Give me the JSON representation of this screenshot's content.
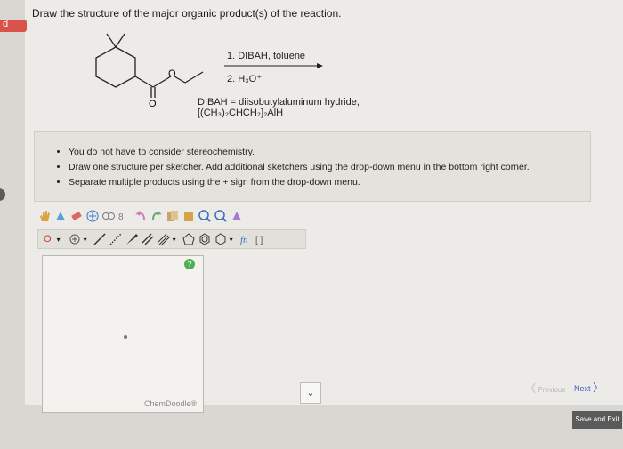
{
  "question": "Draw the structure of the major organic product(s) of the reaction.",
  "reaction": {
    "step1": "1. DIBAH, toluene",
    "step2": "2. H₃O⁺",
    "dibah_line1": "DIBAH = diisobutylaluminum hydride,",
    "dibah_line2": "[(CH₃)₂CHCH₂]₂AlH",
    "atom_o1": "O",
    "atom_o2": "O"
  },
  "instructions": [
    "You do not have to consider stereochemistry.",
    "Draw one structure per sketcher. Add additional sketchers using the drop-down menu in the bottom right corner.",
    "Separate multiple products using the + sign from the drop-down menu."
  ],
  "toolbar2": {
    "atom_label": "O"
  },
  "sketcher": {
    "brand": "ChemDoodle®",
    "help": "?"
  },
  "nav": {
    "previous": "Previous",
    "next": "Next",
    "save": "Save and Exit"
  },
  "left_tab": "d"
}
